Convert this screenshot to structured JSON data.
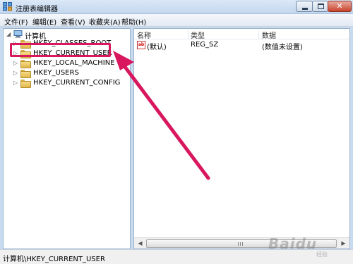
{
  "window": {
    "title": "注册表编辑器",
    "controls": {
      "close": "✕"
    }
  },
  "menu": [
    "文件(F)",
    "编辑(E)",
    "查看(V)",
    "收藏夹(A)",
    "帮助(H)"
  ],
  "tree": {
    "root": "计算机",
    "keys": [
      "HKEY_CLASSES_ROOT",
      "HKEY_CURRENT_USER",
      "HKEY_LOCAL_MACHINE",
      "HKEY_USERS",
      "HKEY_CURRENT_CONFIG"
    ],
    "selected": "HKEY_CURRENT_USER"
  },
  "list": {
    "columns": [
      "名称",
      "类型",
      "数据"
    ],
    "rows": [
      {
        "icon": "string-value-icon",
        "name": "(默认)",
        "type": "REG_SZ",
        "data": "(数值未设置)"
      }
    ]
  },
  "statusbar": {
    "path": "计算机\\HKEY_CURRENT_USER"
  },
  "annotation": {
    "color": "#d8175e"
  },
  "watermark": {
    "brand": "Baidu",
    "sub": "经验"
  }
}
